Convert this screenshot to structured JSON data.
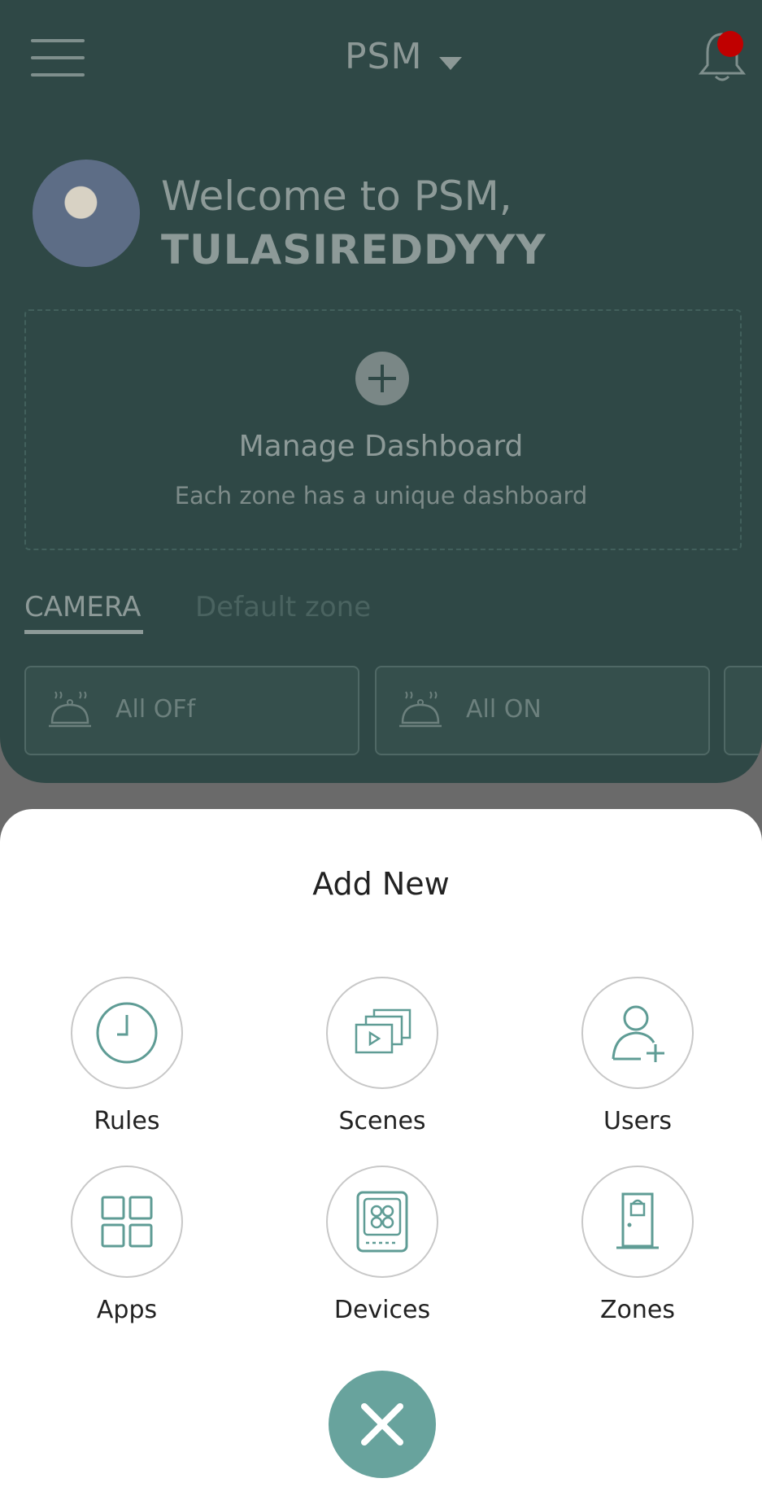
{
  "header": {
    "title": "PSM"
  },
  "welcome": {
    "greeting": "Welcome to PSM,",
    "username": "TULASIREDDYYY"
  },
  "dashboard": {
    "manage_title": "Manage Dashboard",
    "manage_subtitle": "Each zone has a unique dashboard"
  },
  "tabs": [
    {
      "label": "CAMERA"
    },
    {
      "label": "Default zone"
    }
  ],
  "scenes": [
    {
      "label": "All OFf"
    },
    {
      "label": "All ON"
    }
  ],
  "sheet": {
    "title": "Add New",
    "options": [
      {
        "label": "Rules",
        "icon": "clock-icon"
      },
      {
        "label": "Scenes",
        "icon": "scenes-icon"
      },
      {
        "label": "Users",
        "icon": "add-user-icon"
      },
      {
        "label": "Apps",
        "icon": "apps-grid-icon"
      },
      {
        "label": "Devices",
        "icon": "device-icon"
      },
      {
        "label": "Zones",
        "icon": "door-icon"
      }
    ]
  },
  "colors": {
    "accent": "#68a39d",
    "app_background": "#2f4846",
    "notification_dot": "#c00000"
  }
}
